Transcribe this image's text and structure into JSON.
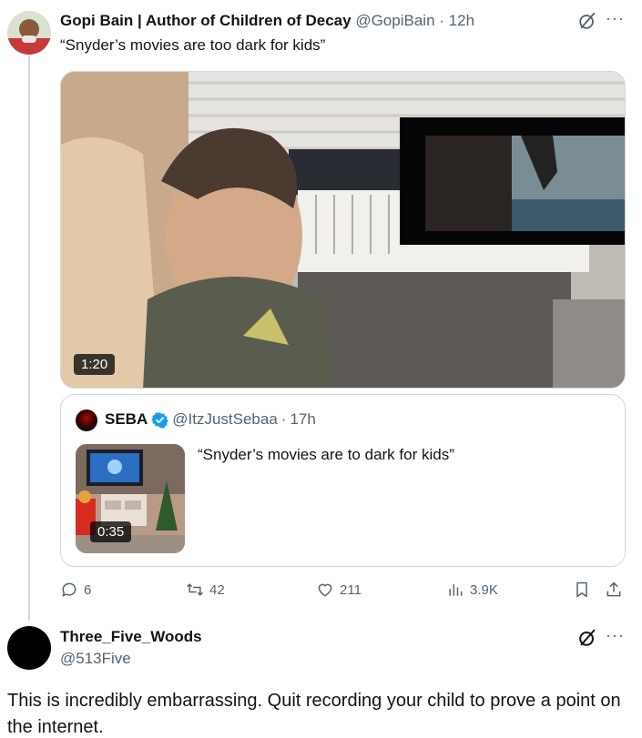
{
  "tweet1": {
    "display_name": "Gopi Bain | Author of Children of Decay",
    "handle": "@GopiBain",
    "separator": "·",
    "time": "12h",
    "text": "“Snyder’s movies are too dark for kids”",
    "video_duration": "1:20",
    "more_label": "···"
  },
  "quote": {
    "display_name": "SEBA",
    "handle": "@ItzJustSebaa",
    "separator": "·",
    "time": "17h",
    "text": "“Snyder’s movies are to dark for kids”",
    "video_duration": "0:35",
    "verified_color": "#1d9bf0"
  },
  "actions": {
    "replies": "6",
    "reposts": "42",
    "likes": "211",
    "views": "3.9K"
  },
  "tweet2": {
    "display_name": "Three_Five_Woods",
    "handle": "@513Five",
    "more_label": "···",
    "text": "This is incredibly embarrassing. Quit recording your child to prove a point on the internet."
  },
  "colors": {
    "text": "#0f1419",
    "muted": "#536471",
    "border": "#cfd9de"
  }
}
